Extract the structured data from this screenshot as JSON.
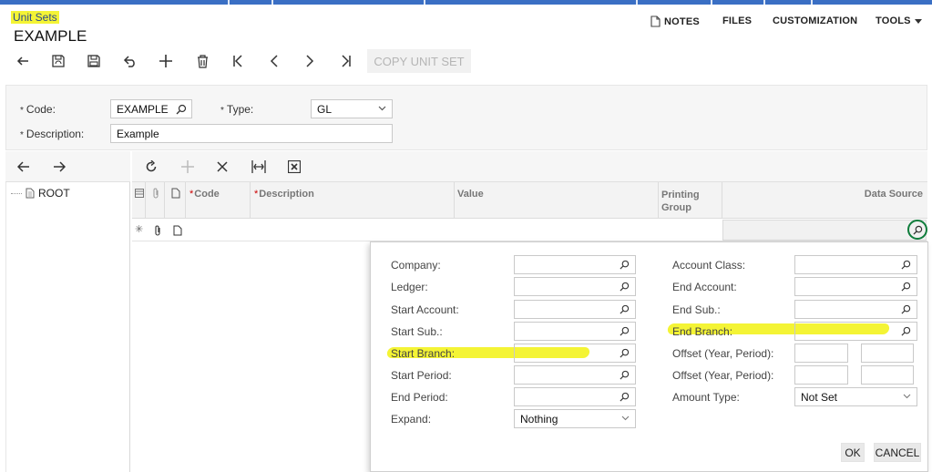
{
  "screen": {
    "breadcrumb": "Unit Sets",
    "title": "EXAMPLE"
  },
  "top_menu": {
    "notes": "NOTES",
    "files": "FILES",
    "customization": "CUSTOMIZATION",
    "tools": "TOOLS"
  },
  "toolbar": {
    "copy_unit_set": "COPY UNIT SET",
    "icons": [
      "back-icon",
      "save-close-icon",
      "save-icon",
      "undo-icon",
      "add-icon",
      "delete-icon",
      "first-icon",
      "previous-icon",
      "next-icon",
      "last-icon"
    ]
  },
  "form": {
    "code_label": "Code:",
    "code_value": "EXAMPLE",
    "type_label": "Type:",
    "type_value": "GL",
    "description_label": "Description:",
    "description_value": "Example"
  },
  "tree": {
    "root": "ROOT"
  },
  "grid": {
    "columns": {
      "code": "Code",
      "description": "Description",
      "value": "Value",
      "printing_group_line1": "Printing",
      "printing_group_line2": "Group",
      "data_source": "Data Source"
    },
    "new_row_marker": "✳"
  },
  "popup": {
    "company": "Company:",
    "ledger": "Ledger:",
    "start_account": "Start Account:",
    "start_sub": "Start Sub.:",
    "start_branch": "Start Branch:",
    "start_period": "Start Period:",
    "end_period": "End Period:",
    "expand": "Expand:",
    "expand_value": "Nothing",
    "account_class": "Account Class:",
    "end_account": "End Account:",
    "end_sub": "End Sub.:",
    "end_branch": "End Branch:",
    "offset1": "Offset (Year, Period):",
    "offset2": "Offset (Year, Period):",
    "amount_type": "Amount Type:",
    "amount_type_value": "Not Set",
    "ok": "OK",
    "cancel": "CANCEL"
  },
  "colors": {
    "accent": "#3a6fc4",
    "highlight": "#f4f435",
    "ring": "#0f7d3c"
  }
}
